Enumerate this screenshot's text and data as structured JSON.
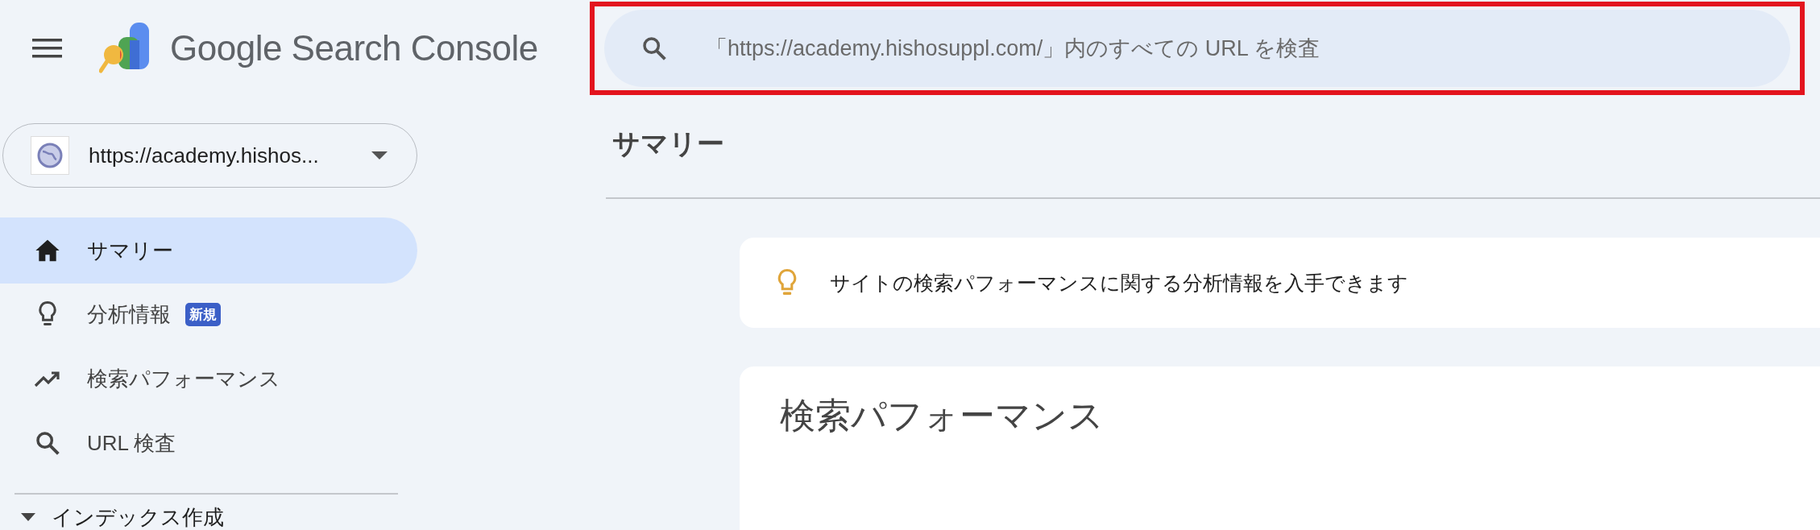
{
  "app": {
    "title": "Google Search Console"
  },
  "search": {
    "placeholder": "「https://academy.hishosuppl.com/」内のすべての URL を検査",
    "highlighted": true
  },
  "property_selector": {
    "value": "https://academy.hishos..."
  },
  "nav": [
    {
      "label": "サマリー",
      "kind": "home",
      "selected": true
    },
    {
      "label": "分析情報",
      "kind": "bulb",
      "badge": "新規",
      "selected": false
    },
    {
      "label": "検索パフォーマンス",
      "kind": "trend",
      "selected": false
    },
    {
      "label": "URL 検査",
      "kind": "search",
      "selected": false
    }
  ],
  "nav_sections": [
    {
      "label": "インデックス作成",
      "expanded": true
    }
  ],
  "page_title": "サマリー",
  "insight_banner": {
    "text": "サイトの検索パフォーマンスに関する分析情報を入手できます"
  },
  "cards": [
    {
      "title": "検索パフォーマンス"
    }
  ]
}
